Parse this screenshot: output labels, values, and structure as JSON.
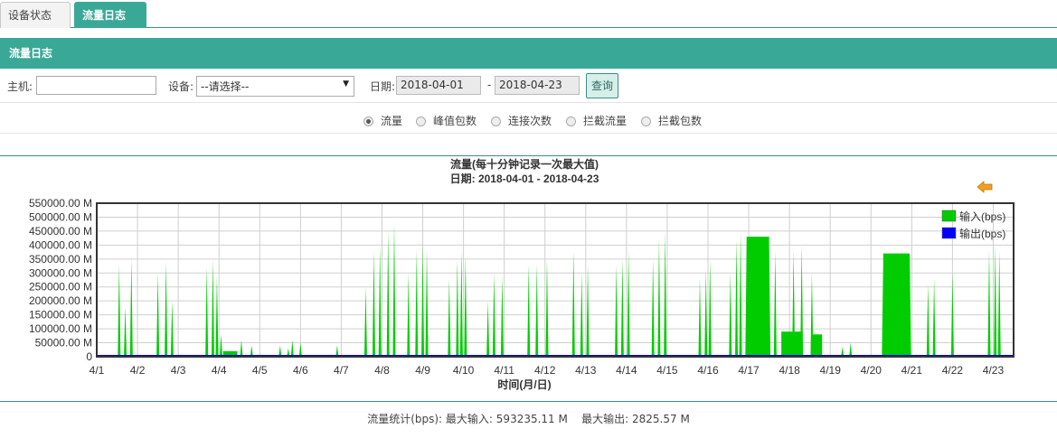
{
  "tabs": [
    {
      "label": "设备状态",
      "close": "×"
    },
    {
      "label": "流量日志",
      "close": "×",
      "active": true
    }
  ],
  "panel": {
    "title": "流量日志"
  },
  "form": {
    "host_label": "主机:",
    "host_value": "",
    "device_label": "设备:",
    "device_value": "--请选择--",
    "date_label": "日期:",
    "date_from": "2018-04-01",
    "date_sep": "-",
    "date_to": "2018-04-23",
    "query_label": "查询"
  },
  "radios": [
    {
      "label": "流量",
      "checked": true
    },
    {
      "label": "峰值包数",
      "checked": false
    },
    {
      "label": "连接次数",
      "checked": false
    },
    {
      "label": "拦截流量",
      "checked": false
    },
    {
      "label": "拦截包数",
      "checked": false
    }
  ],
  "icons": {
    "back": "arrow-left-icon"
  },
  "colors": {
    "accent": "#3aa897",
    "input_series": "#00cc00",
    "output_series": "#0000ff"
  },
  "chart_data": {
    "type": "area",
    "title": "流量(每十分钟记录一次最大值)",
    "subtitle": "日期: 2018-04-01 - 2018-04-23",
    "xlabel": "时间(月/日)",
    "ylabel": "",
    "y_tick_labels": [
      "0",
      "50000.00 M",
      "100000.00 M",
      "150000.00 M",
      "200000.00 M",
      "250000.00 M",
      "300000.00 M",
      "350000.00 M",
      "400000.00 M",
      "450000.00 M",
      "500000.00 M",
      "550000.00 M"
    ],
    "ylim": [
      0,
      550000
    ],
    "x_categories": [
      "4/1",
      "4/2",
      "4/3",
      "4/4",
      "4/5",
      "4/6",
      "4/7",
      "4/8",
      "4/9",
      "4/10",
      "4/11",
      "4/12",
      "4/13",
      "4/14",
      "4/15",
      "4/16",
      "4/17",
      "4/18",
      "4/19",
      "4/20",
      "4/21",
      "4/22",
      "4/23"
    ],
    "grid": true,
    "legend_position": "top-right",
    "series": [
      {
        "name": "输入(bps)",
        "color": "#00cc00",
        "spikes": [
          [
            0.55,
            330000
          ],
          [
            0.7,
            180000
          ],
          [
            0.85,
            350000
          ],
          [
            1.5,
            300000
          ],
          [
            1.7,
            340000
          ],
          [
            1.85,
            200000
          ],
          [
            2.7,
            320000
          ],
          [
            2.85,
            350000
          ],
          [
            2.95,
            290000
          ],
          [
            3.05,
            80000
          ],
          [
            3.55,
            60000
          ],
          [
            3.8,
            40000
          ],
          [
            4.5,
            40000
          ],
          [
            4.7,
            30000
          ],
          [
            4.8,
            60000
          ],
          [
            5.0,
            50000
          ],
          [
            5.9,
            40000
          ],
          [
            6.6,
            250000
          ],
          [
            6.8,
            380000
          ],
          [
            6.95,
            400000
          ],
          [
            7.15,
            450000
          ],
          [
            7.3,
            480000
          ],
          [
            7.65,
            300000
          ],
          [
            7.85,
            380000
          ],
          [
            8.0,
            400000
          ],
          [
            8.1,
            380000
          ],
          [
            8.65,
            280000
          ],
          [
            8.85,
            350000
          ],
          [
            8.95,
            380000
          ],
          [
            9.05,
            360000
          ],
          [
            9.6,
            200000
          ],
          [
            9.75,
            300000
          ],
          [
            9.95,
            290000
          ],
          [
            10.6,
            330000
          ],
          [
            10.8,
            330000
          ],
          [
            11.05,
            350000
          ],
          [
            11.7,
            380000
          ],
          [
            11.9,
            300000
          ],
          [
            12.05,
            330000
          ],
          [
            12.75,
            330000
          ],
          [
            12.9,
            350000
          ],
          [
            13.05,
            380000
          ],
          [
            13.65,
            350000
          ],
          [
            13.8,
            420000
          ],
          [
            13.95,
            450000
          ],
          [
            14.8,
            280000
          ],
          [
            14.95,
            310000
          ],
          [
            15.05,
            350000
          ],
          [
            15.55,
            300000
          ],
          [
            15.7,
            420000
          ],
          [
            15.8,
            450000
          ],
          [
            15.95,
            440000
          ],
          [
            16.5,
            400000
          ],
          [
            16.65,
            380000
          ],
          [
            17.1,
            380000
          ],
          [
            17.3,
            400000
          ],
          [
            17.55,
            300000
          ],
          [
            18.3,
            35000
          ],
          [
            18.5,
            50000
          ],
          [
            19.3,
            330000
          ],
          [
            19.55,
            340000
          ],
          [
            19.75,
            390000
          ],
          [
            19.95,
            370000
          ],
          [
            20.4,
            260000
          ],
          [
            20.55,
            280000
          ],
          [
            21.0,
            300000
          ],
          [
            21.9,
            380000
          ],
          [
            22.05,
            400000
          ],
          [
            22.15,
            380000
          ]
        ],
        "blocks": [
          {
            "from": 3.1,
            "to": 3.45,
            "value": 20000
          },
          {
            "from": 15.95,
            "to": 16.5,
            "value": 430000
          },
          {
            "from": 16.8,
            "to": 17.3,
            "value": 90000
          },
          {
            "from": 17.55,
            "to": 17.8,
            "value": 80000
          },
          {
            "from": 19.3,
            "to": 19.95,
            "value": 370000
          }
        ]
      },
      {
        "name": "输出(bps)",
        "color": "#0000ff",
        "values_note_max": 2825.57
      }
    ]
  },
  "stats": {
    "label": "流量统计(bps):",
    "max_in_label": "最大输入:",
    "max_in": "593235.11 M",
    "max_out_label": "最大输出:",
    "max_out": "2825.57 M"
  }
}
